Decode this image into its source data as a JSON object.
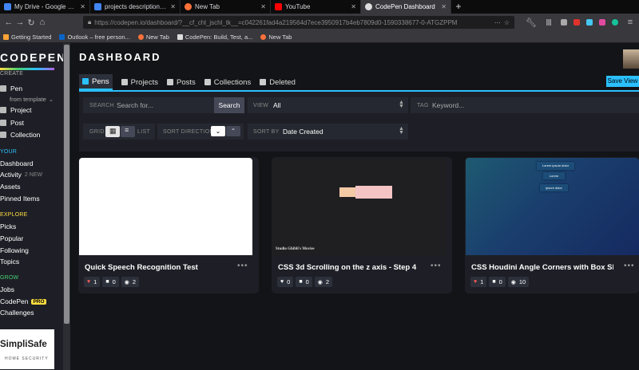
{
  "browser": {
    "tabs": [
      {
        "title": "My Drive - Google Drive",
        "color": "#4285f4"
      },
      {
        "title": "projects descriptions - Google",
        "color": "#4285f4"
      },
      {
        "title": "New Tab",
        "color": "#ff7139"
      },
      {
        "title": "YouTube",
        "color": "#ff0000"
      },
      {
        "title": "CodePen Dashboard",
        "color": "#dddddd"
      }
    ],
    "url": "https://codepen.io/dashboard/?__cf_chl_jschl_tk__=c042261fad4a219564d7ece3950917b4eb7809d0-1590338677-0-ATGZPPM",
    "bookmarks": [
      "Getting Started",
      "Outlook – free person...",
      "New Tab",
      "CodePen: Build, Test, a...",
      "New Tab"
    ]
  },
  "sidebar": {
    "logo": "CODEPEN",
    "create_label": "CREATE",
    "pen": "Pen",
    "from_template": "from template",
    "project": "Project",
    "post": "Post",
    "collection": "Collection",
    "your_label": "YOUR",
    "dashboard": "Dashboard",
    "activity": "Activity",
    "activity_badge": "2 NEW",
    "assets": "Assets",
    "pinned": "Pinned Items",
    "explore_label": "EXPLORE",
    "picks": "Picks",
    "popular": "Popular",
    "following": "Following",
    "topics": "Topics",
    "grow_label": "GROW",
    "jobs": "Jobs",
    "codepen": "CodePen",
    "pro": "PRO",
    "challenges": "Challenges",
    "ad_title": "SimpliSafe",
    "ad_sub": "HOME SECURITY"
  },
  "main": {
    "title": "DASHBOARD",
    "save_view": "Save View",
    "tabs": [
      "Pens",
      "Projects",
      "Posts",
      "Collections",
      "Deleted"
    ],
    "filters": {
      "search_label": "SEARCH",
      "search_placeholder": "Search for...",
      "search_button": "Search",
      "view_label": "VIEW",
      "view_value": "All",
      "tag_label": "TAG",
      "tag_placeholder": "Keyword...",
      "grid_label": "GRID",
      "list_label": "LIST",
      "sort_direction_label": "SORT DIRECTION",
      "sort_by_label": "SORT BY",
      "sort_by_value": "Date Created"
    }
  },
  "cards": [
    {
      "title": "Quick Speech Recognition Test",
      "likes": "1",
      "comments": "0",
      "views": "2",
      "liked": true
    },
    {
      "title": "CSS 3d Scrolling on the z axis - Step 4",
      "likes": "0",
      "comments": "0",
      "views": "2",
      "liked": false,
      "thumb_label": "Studio Ghibli's Movies"
    },
    {
      "title": "CSS Houdini Angle Corners with Box Sha...",
      "likes": "1",
      "comments": "0",
      "views": "10",
      "liked": true,
      "thumb_items": [
        "Lorem ipsum dolor",
        "Lorem",
        "ipsum dolor"
      ]
    }
  ]
}
